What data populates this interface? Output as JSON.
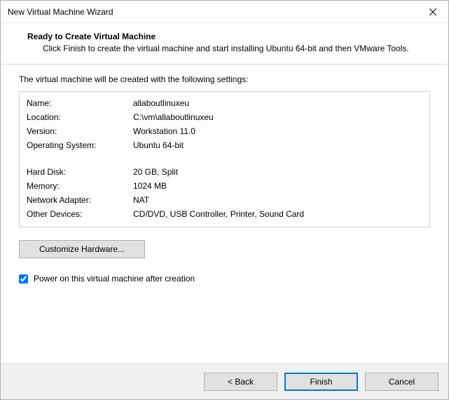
{
  "window": {
    "title": "New Virtual Machine Wizard"
  },
  "header": {
    "heading": "Ready to Create Virtual Machine",
    "subtext": "Click Finish to create the virtual machine and start installing Ubuntu 64-bit and then VMware Tools."
  },
  "content": {
    "intro": "The virtual machine will be created with the following settings:",
    "settings": {
      "group1": [
        {
          "label": "Name:",
          "value": "allaboutlinuxeu"
        },
        {
          "label": "Location:",
          "value": "C:\\vm\\allaboutlinuxeu"
        },
        {
          "label": "Version:",
          "value": "Workstation 11.0"
        },
        {
          "label": "Operating System:",
          "value": "Ubuntu 64-bit"
        }
      ],
      "group2": [
        {
          "label": "Hard Disk:",
          "value": "20 GB, Split"
        },
        {
          "label": "Memory:",
          "value": "1024 MB"
        },
        {
          "label": "Network Adapter:",
          "value": "NAT"
        },
        {
          "label": "Other Devices:",
          "value": "CD/DVD, USB Controller, Printer, Sound Card"
        }
      ]
    },
    "customize_label": "Customize Hardware...",
    "poweron_label": "Power on this virtual machine after creation",
    "poweron_checked": true
  },
  "footer": {
    "back": "< Back",
    "finish": "Finish",
    "cancel": "Cancel"
  }
}
